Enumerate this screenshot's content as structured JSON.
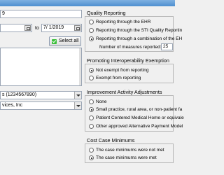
{
  "left": {
    "top_field_value": "9",
    "date_from": "",
    "date_to_label": "to",
    "date_to": "7/ 1/2019",
    "select_all_label": "Select all",
    "dropdown1_value": "s (1234567890)",
    "dropdown2_value": "vices, Inc"
  },
  "quality": {
    "title": "Quality Reporting",
    "options": [
      "Reporting through the EHR",
      "Reporting through the STI Quality Reportin",
      "Reporting through a combination of the EH"
    ],
    "selected_index": 2,
    "measures_label": "Number of measures reported:",
    "measures_value": "25"
  },
  "interop": {
    "title": "Promoting Interoperability Exemption",
    "options": [
      "Not exempt from reporting",
      "Exempt from reporting"
    ],
    "selected_index": 0
  },
  "improvement": {
    "title": "Improvement Activity Adjustments",
    "options": [
      "None",
      "Small practice, rural area, or non-patient fa",
      "Patient Centered Medical Home or equivale",
      "Other approved Alternative Payment Model"
    ],
    "selected_index": 1
  },
  "cost": {
    "title": "Cost Case Minimums",
    "options": [
      "The case minimums were not met",
      "The case minimums were met"
    ],
    "selected_index": 1
  }
}
